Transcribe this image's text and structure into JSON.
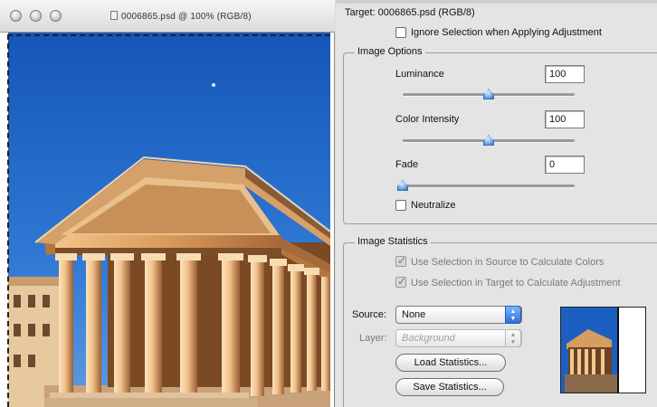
{
  "document": {
    "title": "0006865.psd @ 100% (RGB/8)"
  },
  "dialog": {
    "target_label": "Target: 0006865.psd (RGB/8)",
    "ignore_selection_label": "Ignore Selection when Applying Adjustment",
    "ignore_selection_checked": false,
    "image_options": {
      "title": "Image Options",
      "luminance": {
        "label": "Luminance",
        "value": "100",
        "slider_fraction": 0.5
      },
      "color_intensity": {
        "label": "Color Intensity",
        "value": "100",
        "slider_fraction": 0.5
      },
      "fade": {
        "label": "Fade",
        "value": "0",
        "slider_fraction": 0.0
      },
      "neutralize": {
        "label": "Neutralize",
        "checked": false
      }
    },
    "image_statistics": {
      "title": "Image Statistics",
      "use_source_selection_label": "Use Selection in Source to Calculate Colors",
      "use_source_selection_checked": true,
      "use_target_selection_label": "Use Selection in Target to Calculate Adjustment",
      "use_target_selection_checked": true,
      "source_label": "Source:",
      "source_value": "None",
      "layer_label": "Layer:",
      "layer_value": "Background",
      "load_button": "Load Statistics...",
      "save_button": "Save Statistics..."
    }
  },
  "colors": {
    "panel_bg": "#e4e4e4",
    "slider_thumb": "#4f8fdb",
    "sky": "#1f63c4",
    "stone": "#d89a5c"
  }
}
